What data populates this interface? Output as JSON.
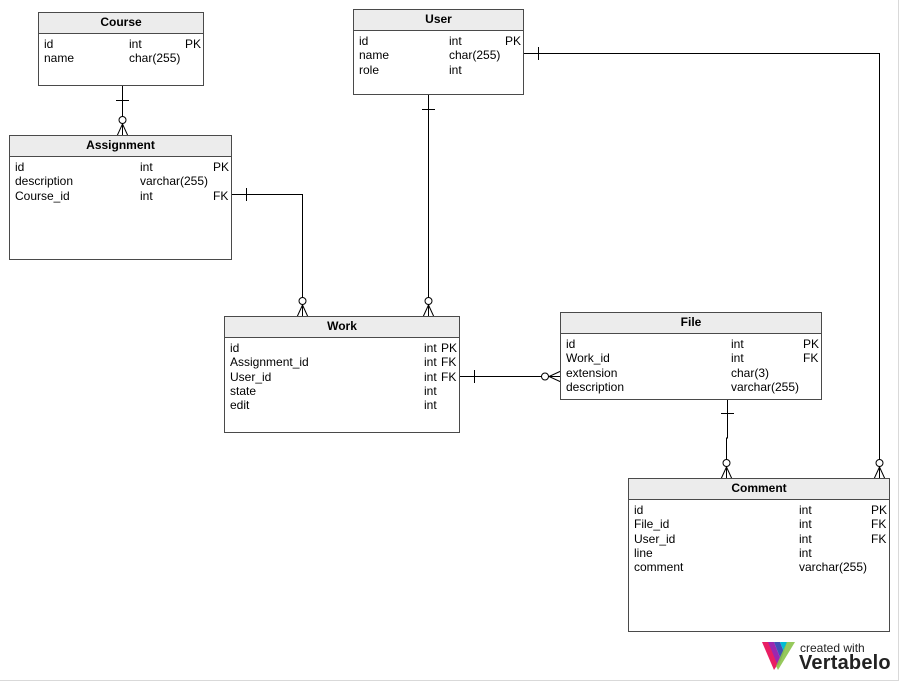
{
  "tables": [
    {
      "id": "course",
      "title": "Course",
      "columns": [
        {
          "name": "id",
          "type": "int",
          "key": "PK"
        },
        {
          "name": "name",
          "type": "char(255)",
          "key": ""
        }
      ]
    },
    {
      "id": "user",
      "title": "User",
      "columns": [
        {
          "name": "id",
          "type": "int",
          "key": "PK"
        },
        {
          "name": "name",
          "type": "char(255)",
          "key": ""
        },
        {
          "name": "role",
          "type": "int",
          "key": ""
        }
      ]
    },
    {
      "id": "assignment",
      "title": "Assignment",
      "columns": [
        {
          "name": "id",
          "type": "int",
          "key": "PK"
        },
        {
          "name": "description",
          "type": "varchar(255)",
          "key": ""
        },
        {
          "name": "Course_id",
          "type": "int",
          "key": "FK"
        }
      ]
    },
    {
      "id": "work",
      "title": "Work",
      "columns": [
        {
          "name": "id",
          "type": "int",
          "key": "PK"
        },
        {
          "name": "Assignment_id",
          "type": "int",
          "key": "FK"
        },
        {
          "name": "User_id",
          "type": "int",
          "key": "FK"
        },
        {
          "name": "state",
          "type": "int",
          "key": ""
        },
        {
          "name": "edit",
          "type": "int",
          "key": ""
        }
      ]
    },
    {
      "id": "file",
      "title": "File",
      "columns": [
        {
          "name": "id",
          "type": "int",
          "key": "PK"
        },
        {
          "name": "Work_id",
          "type": "int",
          "key": "FK"
        },
        {
          "name": "extension",
          "type": "char(3)",
          "key": ""
        },
        {
          "name": "description",
          "type": "varchar(255)",
          "key": ""
        }
      ]
    },
    {
      "id": "comment",
      "title": "Comment",
      "columns": [
        {
          "name": "id",
          "type": "int",
          "key": "PK"
        },
        {
          "name": "File_id",
          "type": "int",
          "key": "FK"
        },
        {
          "name": "User_id",
          "type": "int",
          "key": "FK"
        },
        {
          "name": "line",
          "type": "int",
          "key": ""
        },
        {
          "name": "comment",
          "type": "varchar(255)",
          "key": ""
        }
      ]
    }
  ],
  "relationships": [
    {
      "from": "course",
      "to": "assignment",
      "from_end": "one",
      "to_end": "zero-or-many"
    },
    {
      "from": "assignment",
      "to": "work",
      "from_end": "one",
      "to_end": "zero-or-many"
    },
    {
      "from": "user",
      "to": "work",
      "from_end": "one",
      "to_end": "zero-or-many"
    },
    {
      "from": "user",
      "to": "comment",
      "from_end": "one",
      "to_end": "zero-or-many"
    },
    {
      "from": "work",
      "to": "file",
      "from_end": "one",
      "to_end": "zero-or-many"
    },
    {
      "from": "file",
      "to": "comment",
      "from_end": "one",
      "to_end": "zero-or-many"
    }
  ],
  "logo": {
    "line1": "created with",
    "line2": "Vertabelo",
    "colors": [
      "#e91e63",
      "#9c27b0",
      "#3f51b5",
      "#00bcd4",
      "#8bc34a"
    ]
  }
}
